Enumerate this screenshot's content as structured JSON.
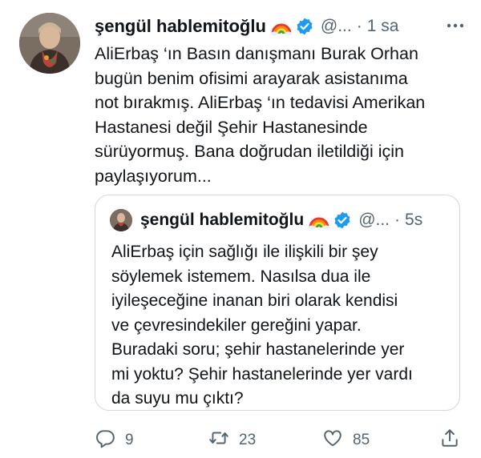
{
  "tweet": {
    "author_name": "şengül hablemitoğlu",
    "handle": "@...",
    "separator": "·",
    "time": "1 sa",
    "text": "AliErbaş ‘ın Basın danışmanı Burak Orhan\nbugün benim ofisimi arayarak asistanıma\nnot bırakmış. AliErbaş ‘ın tedavisi Amerikan\nHastanesi değil Şehir Hastanesinde\nsürüyormuş. Bana doğrudan iletildiği için\npaylaşıyorum..."
  },
  "quoted_tweet": {
    "author_name": "şengül hablemitoğlu",
    "handle": "@...",
    "separator": "·",
    "time": "5s",
    "text": "AliErbaş için sağlığı ile ilişkili bir şey\nsöylemek istemem. Nasılsa dua ile\niyileşeceğine inanan biri olarak kendisi\nve çevresindekiler gereğini yapar.\nBuradaki soru; şehir hastanelerinde yer\nmi yoktu? Şehir hastanelerinde yer vardı\nda suyu mu çıktı?"
  },
  "actions": {
    "reply_count": "9",
    "retweet_count": "23",
    "like_count": "85"
  },
  "icons": {
    "more": "more-icon",
    "verified": "verified-badge-icon",
    "rainbow": "rainbow-emoji-icon",
    "reply": "reply-icon",
    "retweet": "retweet-icon",
    "like": "like-icon",
    "share": "share-icon"
  },
  "colors": {
    "text": "#0f1419",
    "secondary": "#536471",
    "verified": "#1d9bf0",
    "border": "#cfd9de"
  }
}
